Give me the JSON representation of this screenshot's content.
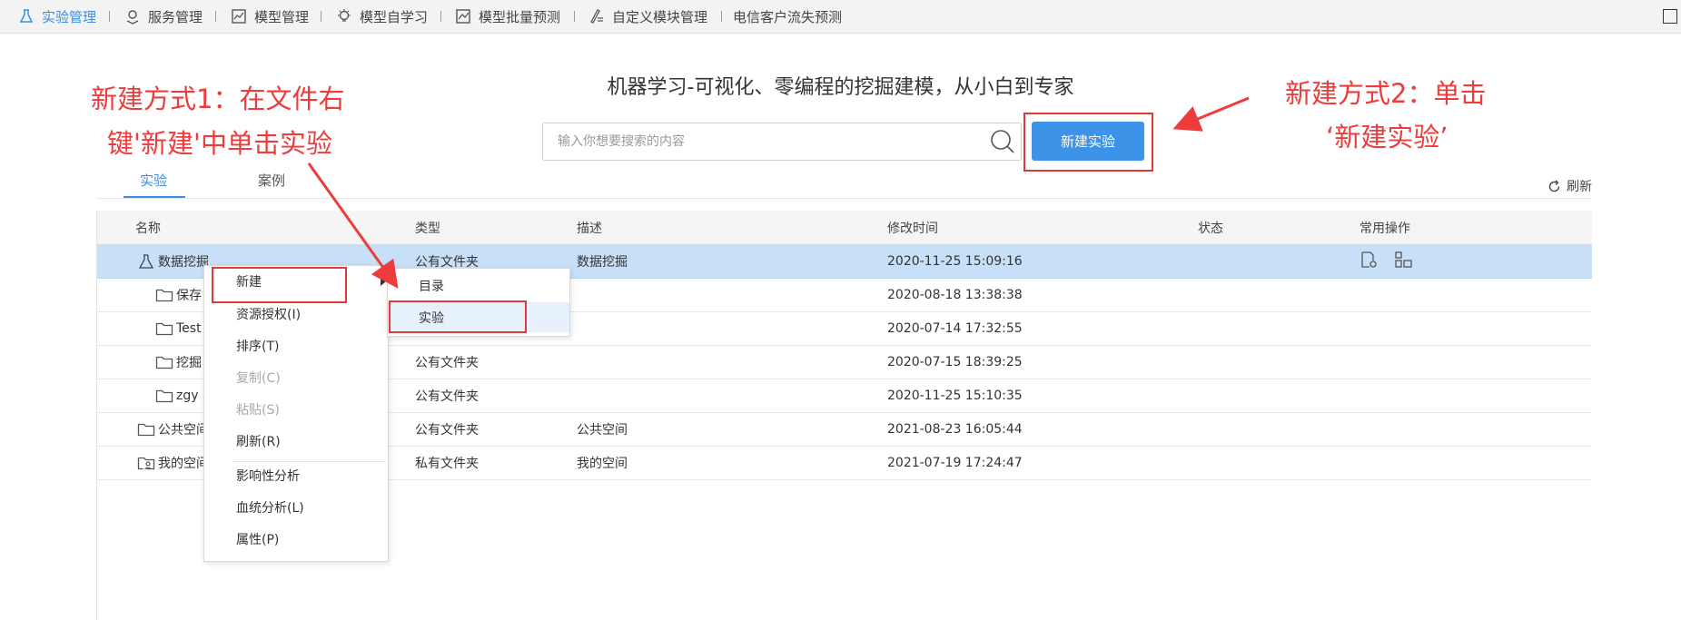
{
  "nav": {
    "items": [
      {
        "label": "实验管理",
        "icon": "flask-icon",
        "active": true
      },
      {
        "label": "服务管理",
        "icon": "location-pin-icon"
      },
      {
        "label": "模型管理",
        "icon": "chart-box-icon"
      },
      {
        "label": "模型自学习",
        "icon": "lightbulb-icon"
      },
      {
        "label": "模型批量预测",
        "icon": "line-chart-icon"
      },
      {
        "label": "自定义模块管理",
        "icon": "pen-list-icon"
      },
      {
        "label": "电信客户流失预测"
      }
    ]
  },
  "headline": "机器学习-可视化、零编程的挖掘建模，从小白到专家",
  "search": {
    "placeholder": "输入你想要搜索的内容",
    "value": ""
  },
  "new_button": "新建实验",
  "tabs": [
    {
      "label": "实验",
      "active": true
    },
    {
      "label": "案例"
    }
  ],
  "refresh": "刷新",
  "table": {
    "columns": [
      "名称",
      "类型",
      "描述",
      "修改时间",
      "状态",
      "常用操作"
    ],
    "rows": [
      {
        "name": "数据挖掘",
        "type": "公有文件夹",
        "desc": "数据挖掘",
        "time": "2020-11-25 15:09:16",
        "icon": "flask-icon",
        "selected": true
      },
      {
        "name": "保存",
        "type": "",
        "desc": "",
        "time": "2020-08-18 13:38:38",
        "icon": "folder-icon"
      },
      {
        "name": "Test",
        "type": "",
        "desc": "",
        "time": "2020-07-14 17:32:55",
        "icon": "folder-icon"
      },
      {
        "name": "挖掘",
        "type": "公有文件夹",
        "desc": "",
        "time": "2020-07-15 18:39:25",
        "icon": "folder-icon"
      },
      {
        "name": "zgy",
        "type": "公有文件夹",
        "desc": "",
        "time": "2020-11-25 15:10:35",
        "icon": "folder-icon"
      },
      {
        "name": "公共空间",
        "type": "公有文件夹",
        "desc": "公共空间",
        "time": "2021-08-23 16:05:44",
        "icon": "folder-icon"
      },
      {
        "name": "我的空间",
        "type": "私有文件夹",
        "desc": "我的空间",
        "time": "2021-07-19 17:24:47",
        "icon": "user-folder-icon"
      }
    ]
  },
  "context_menu": {
    "items": [
      {
        "label": "新建",
        "submenu": true
      },
      {
        "label": "资源授权(I)"
      },
      {
        "label": "排序(T)"
      },
      {
        "label": "复制(C)",
        "disabled": true
      },
      {
        "label": "粘贴(S)",
        "disabled": true
      },
      {
        "label": "刷新(R)"
      },
      {
        "label": "影响性分析"
      },
      {
        "label": "血统分析(L)"
      },
      {
        "label": "属性(P)"
      }
    ],
    "submenu": [
      {
        "label": "目录"
      },
      {
        "label": "实验",
        "hover": true
      }
    ]
  },
  "annotations": {
    "left_line1": "新建方式1：在文件右",
    "left_line2": "键'新建'中单击实验",
    "right_line1": "新建方式2：单击",
    "right_line2": "‘新建实验’"
  },
  "colors": {
    "accent": "#3a8ee6",
    "button": "#3d93e7",
    "selected_row": "#c7e0f7",
    "annotation": "#ee3b3b"
  }
}
